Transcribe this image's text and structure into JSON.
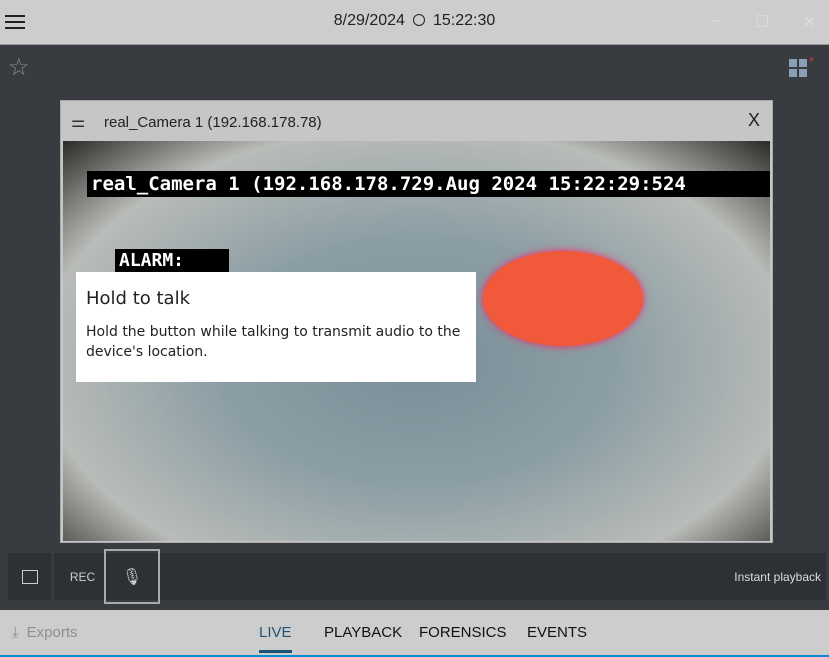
{
  "titlebar": {
    "date": "8/29/2024",
    "time": "15:22:30",
    "minimize": "–",
    "maximize": "☐",
    "close": "✕"
  },
  "camera": {
    "title": "real_Camera 1 (192.168.178.78)",
    "close": "X",
    "osd_line": "real_Camera 1 (192.168.178.729.Aug 2024  15:22:29:524",
    "osd_alarm": "ALARM:"
  },
  "tooltip": {
    "title": "Hold to talk",
    "body": "Hold the button while talking to transmit audio to the device's location."
  },
  "controls": {
    "rec": "REC",
    "instant_playback": "Instant playback"
  },
  "bottom": {
    "exports": "Exports",
    "tabs": [
      "LIVE",
      "PLAYBACK",
      "FORENSICS",
      "EVENTS"
    ]
  },
  "colors": {
    "accent": "#1c5478",
    "alarm_red": "#e03030"
  }
}
